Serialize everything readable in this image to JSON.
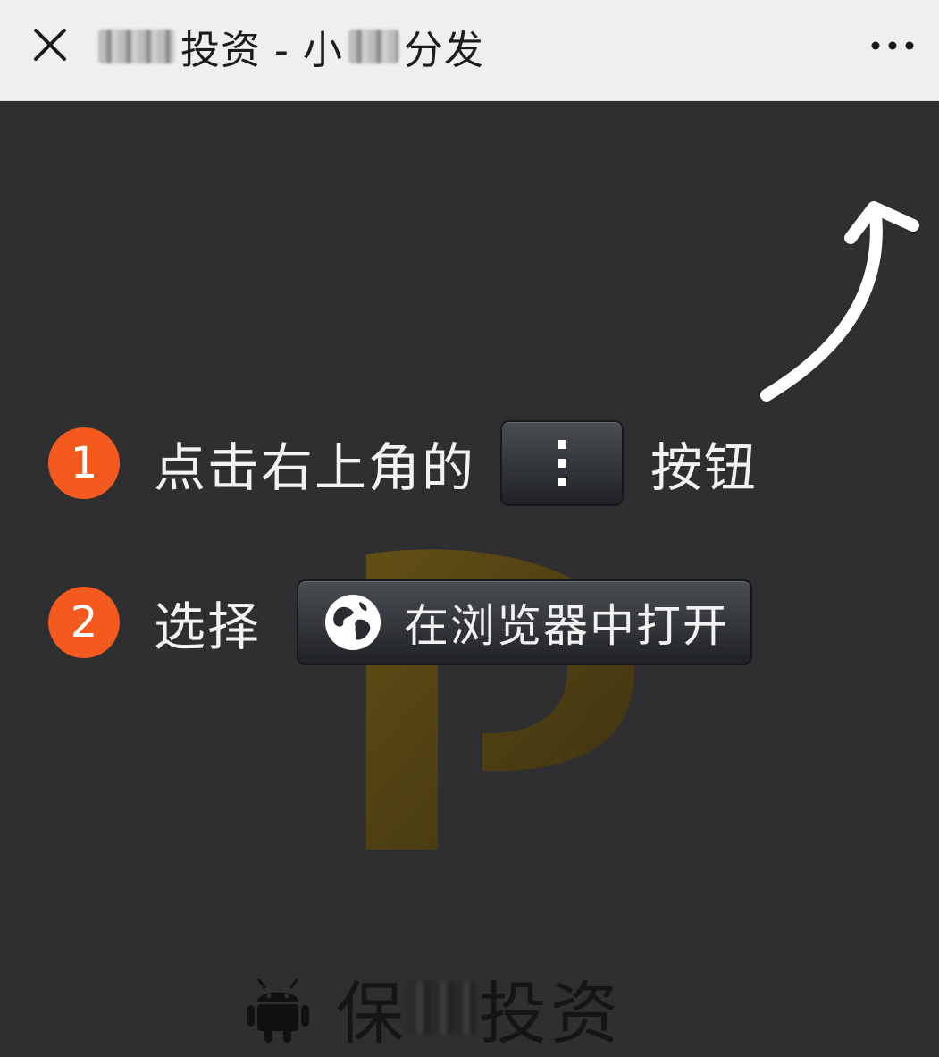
{
  "header": {
    "close_icon": "close-icon",
    "title_part1": "投资 - 小",
    "title_part2": "分发",
    "more_icon": "more-dots-icon"
  },
  "steps": [
    {
      "number": "1",
      "text_before": "点击右上角的",
      "button_icon": "vertical-dots-icon",
      "text_after": "按钮"
    },
    {
      "number": "2",
      "text_before": "选择",
      "button_icon": "globe-icon",
      "button_label": "在浏览器中打开"
    }
  ],
  "footer": {
    "platform_icon": "android-icon",
    "app_name_part1": "保",
    "app_name_part2": "投资"
  },
  "colors": {
    "background": "#2f2e30",
    "header_bg": "#efeff1",
    "step_badge": "#f45a1e",
    "logo_watermark": "#5a4712"
  }
}
